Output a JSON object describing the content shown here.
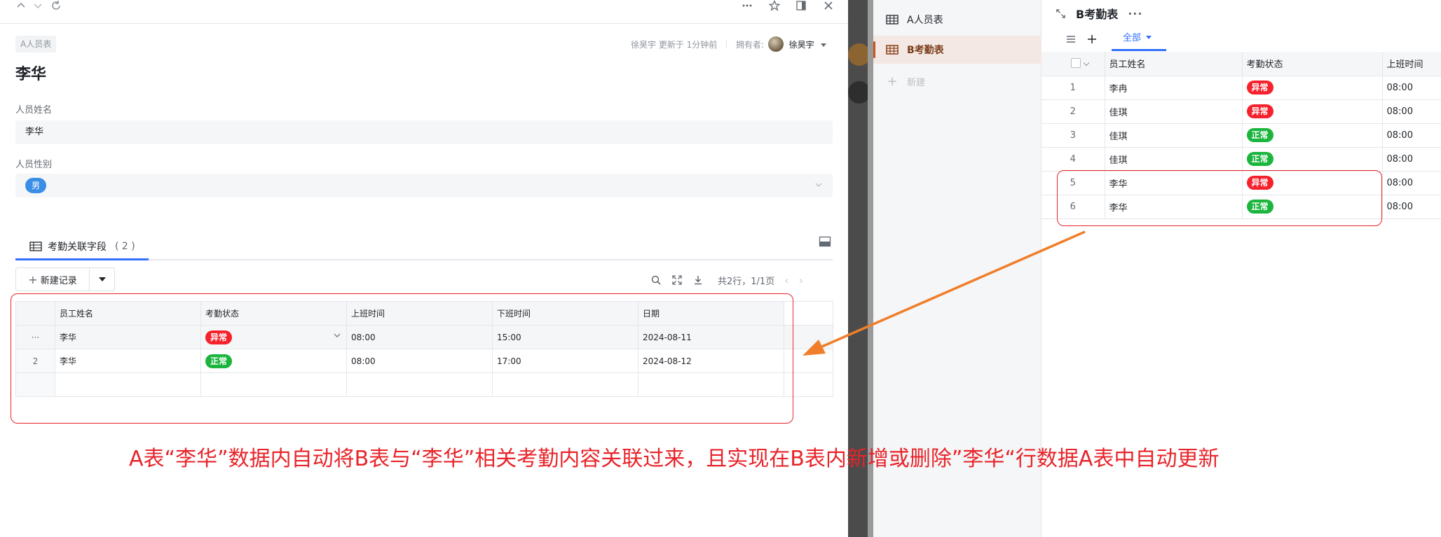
{
  "topbar": {
    "icons": [
      "chevron-up-icon",
      "chevron-down-icon",
      "refresh-icon",
      "more-icon",
      "star-icon",
      "sidebar-toggle-icon",
      "close-icon"
    ]
  },
  "record": {
    "table_tag": "A人员表",
    "title": "李华",
    "meta": {
      "updated": "徐昊宇 更新于 1分钟前",
      "owner_label": "拥有者:",
      "owner": "徐昊宇"
    },
    "fields": {
      "name_label": "人员姓名",
      "name_value": "李华",
      "gender_label": "人员性别",
      "gender_value": "男"
    }
  },
  "linked": {
    "tab_label": "考勤关联字段",
    "tab_count": "( 2 )",
    "new_button": "新建记录",
    "pagination": "共2行，1/1页",
    "columns": [
      "员工姓名",
      "考勤状态",
      "上班时间",
      "下班时间",
      "日期"
    ],
    "rows": [
      {
        "idx": "···",
        "name": "李华",
        "status": "异常",
        "status_color": "#f5222d",
        "start": "08:00",
        "end": "15:00",
        "date": "2024-08-11"
      },
      {
        "idx": "2",
        "name": "李华",
        "status": "正常",
        "status_color": "#1bb53e",
        "start": "08:00",
        "end": "17:00",
        "date": "2024-08-12"
      }
    ]
  },
  "sidebar": {
    "items": [
      {
        "label": "A人员表"
      },
      {
        "label": "B考勤表"
      },
      {
        "label": "新建"
      }
    ]
  },
  "grid": {
    "title": "B考勤表",
    "more": "···",
    "view_tab": "全部",
    "columns": [
      "员工姓名",
      "考勤状态",
      "上班时间"
    ],
    "rows": [
      {
        "idx": "1",
        "name": "李冉",
        "status": "异常",
        "start": "08:00"
      },
      {
        "idx": "2",
        "name": "佳琪",
        "status": "异常",
        "start": "08:00"
      },
      {
        "idx": "3",
        "name": "佳琪",
        "status": "正常",
        "start": "08:00"
      },
      {
        "idx": "4",
        "name": "佳琪",
        "status": "正常",
        "start": "08:00"
      },
      {
        "idx": "5",
        "name": "李华",
        "status": "异常",
        "start": "08:00"
      },
      {
        "idx": "6",
        "name": "李华",
        "status": "正常",
        "start": "08:00"
      }
    ]
  },
  "caption": "A表“李华”数据内自动将B表与“李华”相关考勤内容关联过来，且实现在B表内新增或删除”李华“行数据A表中自动更新",
  "colors": {
    "accent": "#3370ff",
    "annotation": "#e8242a",
    "arrow": "#f07e2a",
    "abnormal": "#f5222d",
    "normal": "#1bb53e"
  }
}
